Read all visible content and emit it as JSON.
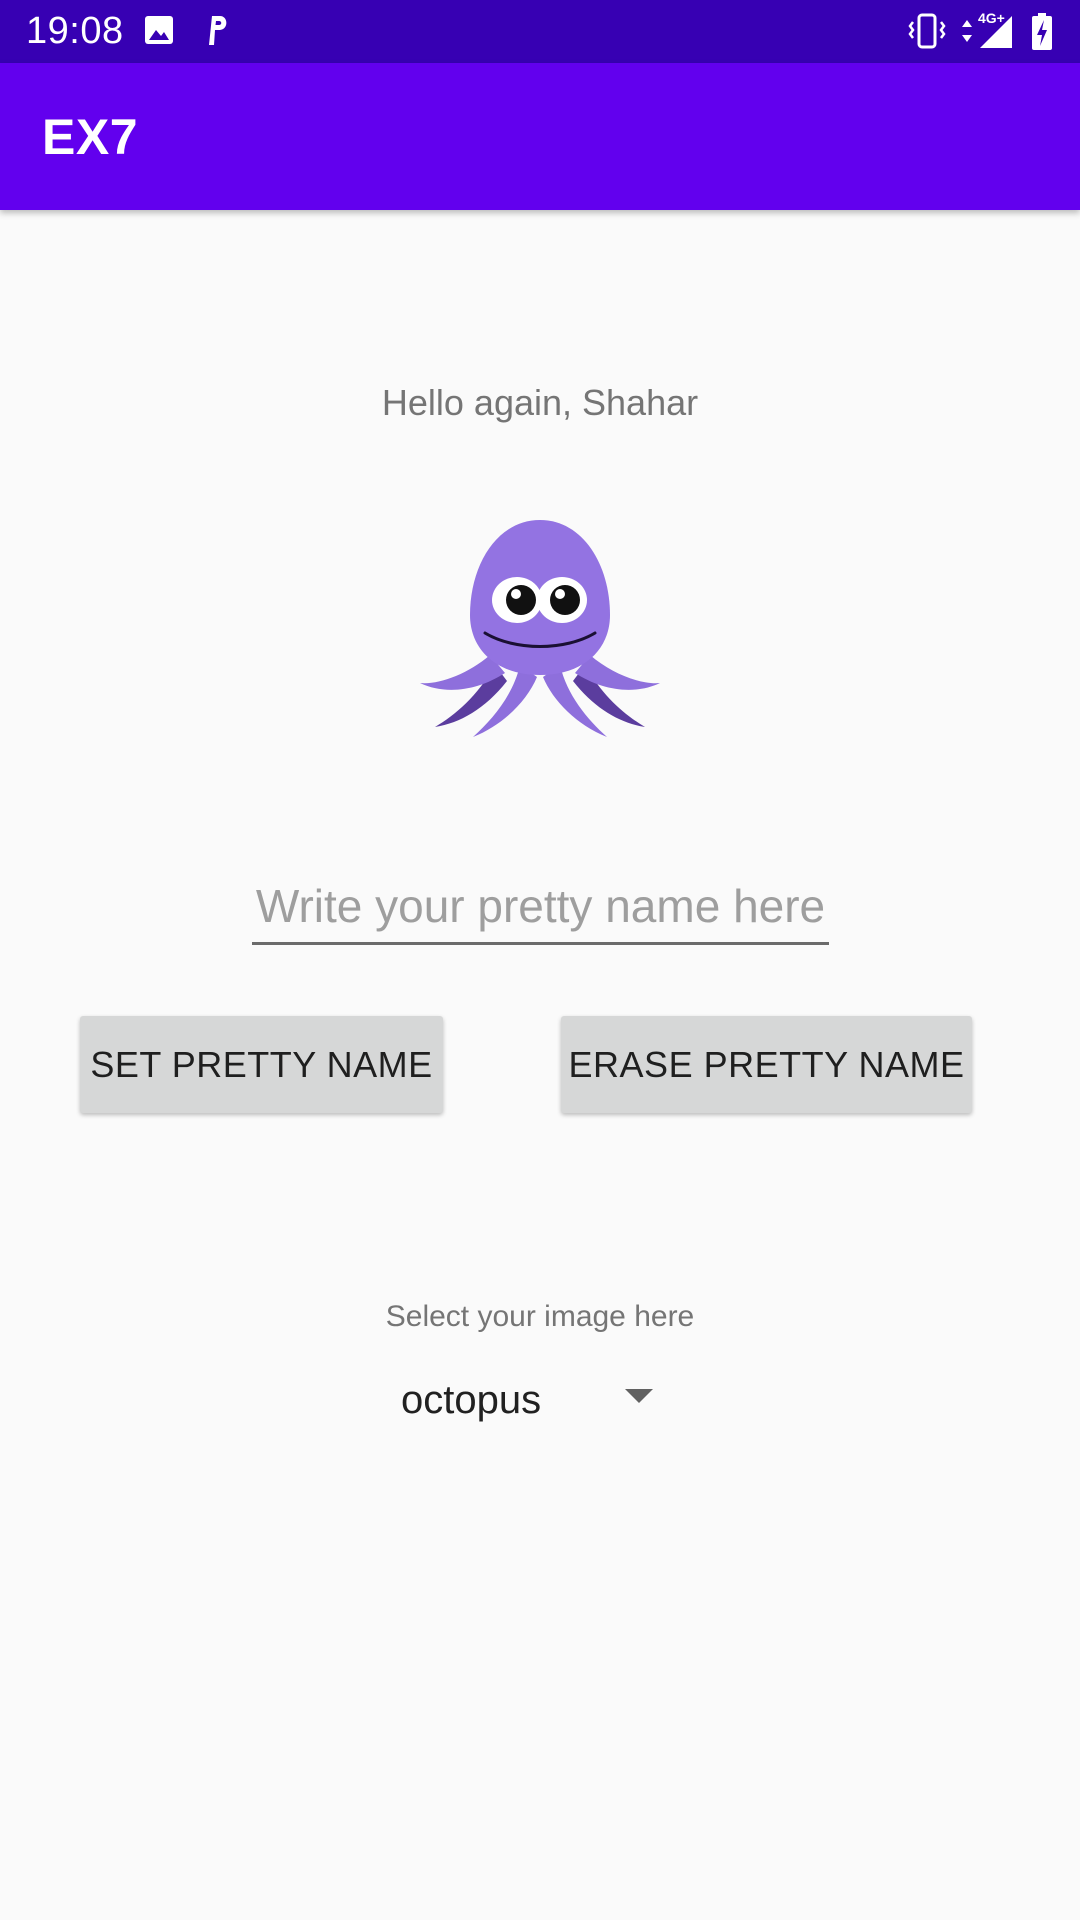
{
  "status_bar": {
    "time": "19:08",
    "left_icons": [
      "image-icon",
      "parking-icon"
    ],
    "right_icons": [
      "vibrate-icon",
      "network-4g-icon",
      "signal-icon",
      "battery-charging-icon"
    ],
    "network_label": "4G+"
  },
  "app_bar": {
    "title": "EX7",
    "color": "#6200ee",
    "status_color": "#3700b3"
  },
  "main": {
    "greeting": "Hello again, Shahar",
    "image": {
      "icon": "octopus-icon",
      "color": "#8e6fdc"
    },
    "name_input": {
      "value": "",
      "placeholder": "Write your pretty name here"
    },
    "buttons": {
      "set_label": "SET PRETTY NAME",
      "erase_label": "ERASE PRETTY NAME"
    },
    "select_label": "Select your image here",
    "selected_image": "octopus"
  }
}
